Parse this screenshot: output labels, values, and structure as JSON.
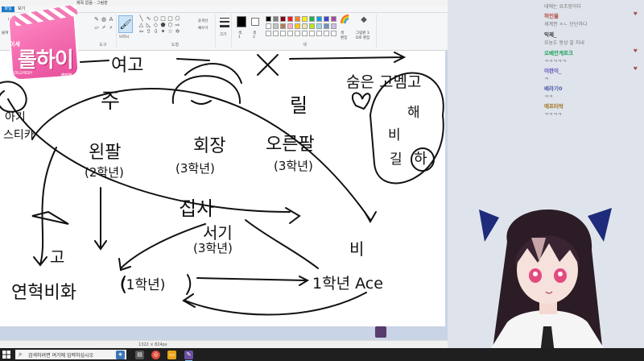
{
  "window": {
    "title": "제목 없음 - 그림판"
  },
  "tabs": {
    "file": "파일",
    "view": "보기"
  },
  "ribbon": {
    "paste": "붙여넣기",
    "groups": {
      "tools": "도구",
      "shapes": "도형",
      "colors": "색"
    },
    "brush_label": "브러시",
    "outline_label": "윤곽선",
    "fill_label": "채우기",
    "size_label": "크기",
    "color1_label": "색\n1",
    "color2_label": "색\n2",
    "edit_colors_label": "색\n편집",
    "paint3d_label": "그림판 3\nD로 편집"
  },
  "palette": [
    "#000000",
    "#7f7f7f",
    "#880015",
    "#ed1c24",
    "#ff7f27",
    "#fff200",
    "#22b14c",
    "#00a2e8",
    "#3f48cc",
    "#a349a4",
    "#ffffff",
    "#c3c3c3",
    "#b97a57",
    "#ffaec9",
    "#ffc90e",
    "#efe4b0",
    "#b5e61d",
    "#99d9ea",
    "#7092be",
    "#c8bfe7",
    "#ffffff",
    "#ffffff",
    "#ffffff",
    "#ffffff",
    "#ffffff",
    "#ffffff",
    "#ffffff",
    "#ffffff",
    "#ffffff",
    "#ffffff"
  ],
  "drawing_text": {
    "school": "여고",
    "ju": "주",
    "li": "릴",
    "agi": "아기",
    "studio": "스티카",
    "left_arm": "왼팔",
    "left_grade": "(2학년)",
    "president": "회장",
    "pres_grade": "(3학년)",
    "right_arm": "오른팔",
    "right_grade": "(3학년)",
    "hiding": "숨은 고멤고",
    "hae": "해",
    "bi_side": "비",
    "gil": "길",
    "ha": "하",
    "jipsa": "집사",
    "seogi": "서기",
    "seogi_grade": "(3학년)",
    "go": "고",
    "bi": "비",
    "yeon": "연혁비화",
    "yeon_grade": "(1학년)",
    "ace": "1학년 Ace"
  },
  "status": {
    "dimensions": "1322 × 824px"
  },
  "logo": {
    "top": "이세",
    "main": "롤하이",
    "bottom_left": "ROLLHIGH",
    "bottom_right": "라이트"
  },
  "chat": [
    {
      "name": "허인율",
      "text": "세계권 ㅈㄴ 단단하다",
      "color": "#b3443c"
    },
    {
      "name": "익제_",
      "text": "요놈도 왕상 잘 지내",
      "color": "#3a3a3a"
    },
    {
      "name": "오베안게르크",
      "text": "ㅋㅋㅋㅋㅋ",
      "color": "#1f9f5a"
    },
    {
      "name": "이란이_",
      "text": "ㅋ",
      "color": "#5b49b8"
    },
    {
      "name": "베라기0",
      "text": "ㅋㅋ",
      "color": "#4d5aa6"
    },
    {
      "name": "에프터박",
      "text": "ㅋㅋㅋㅋ",
      "color": "#a3741f"
    }
  ],
  "chat_top_text": "네에는 요조장이다",
  "taskbar": {
    "search_placeholder": "검색하려면 여기에 입력하십시오"
  }
}
